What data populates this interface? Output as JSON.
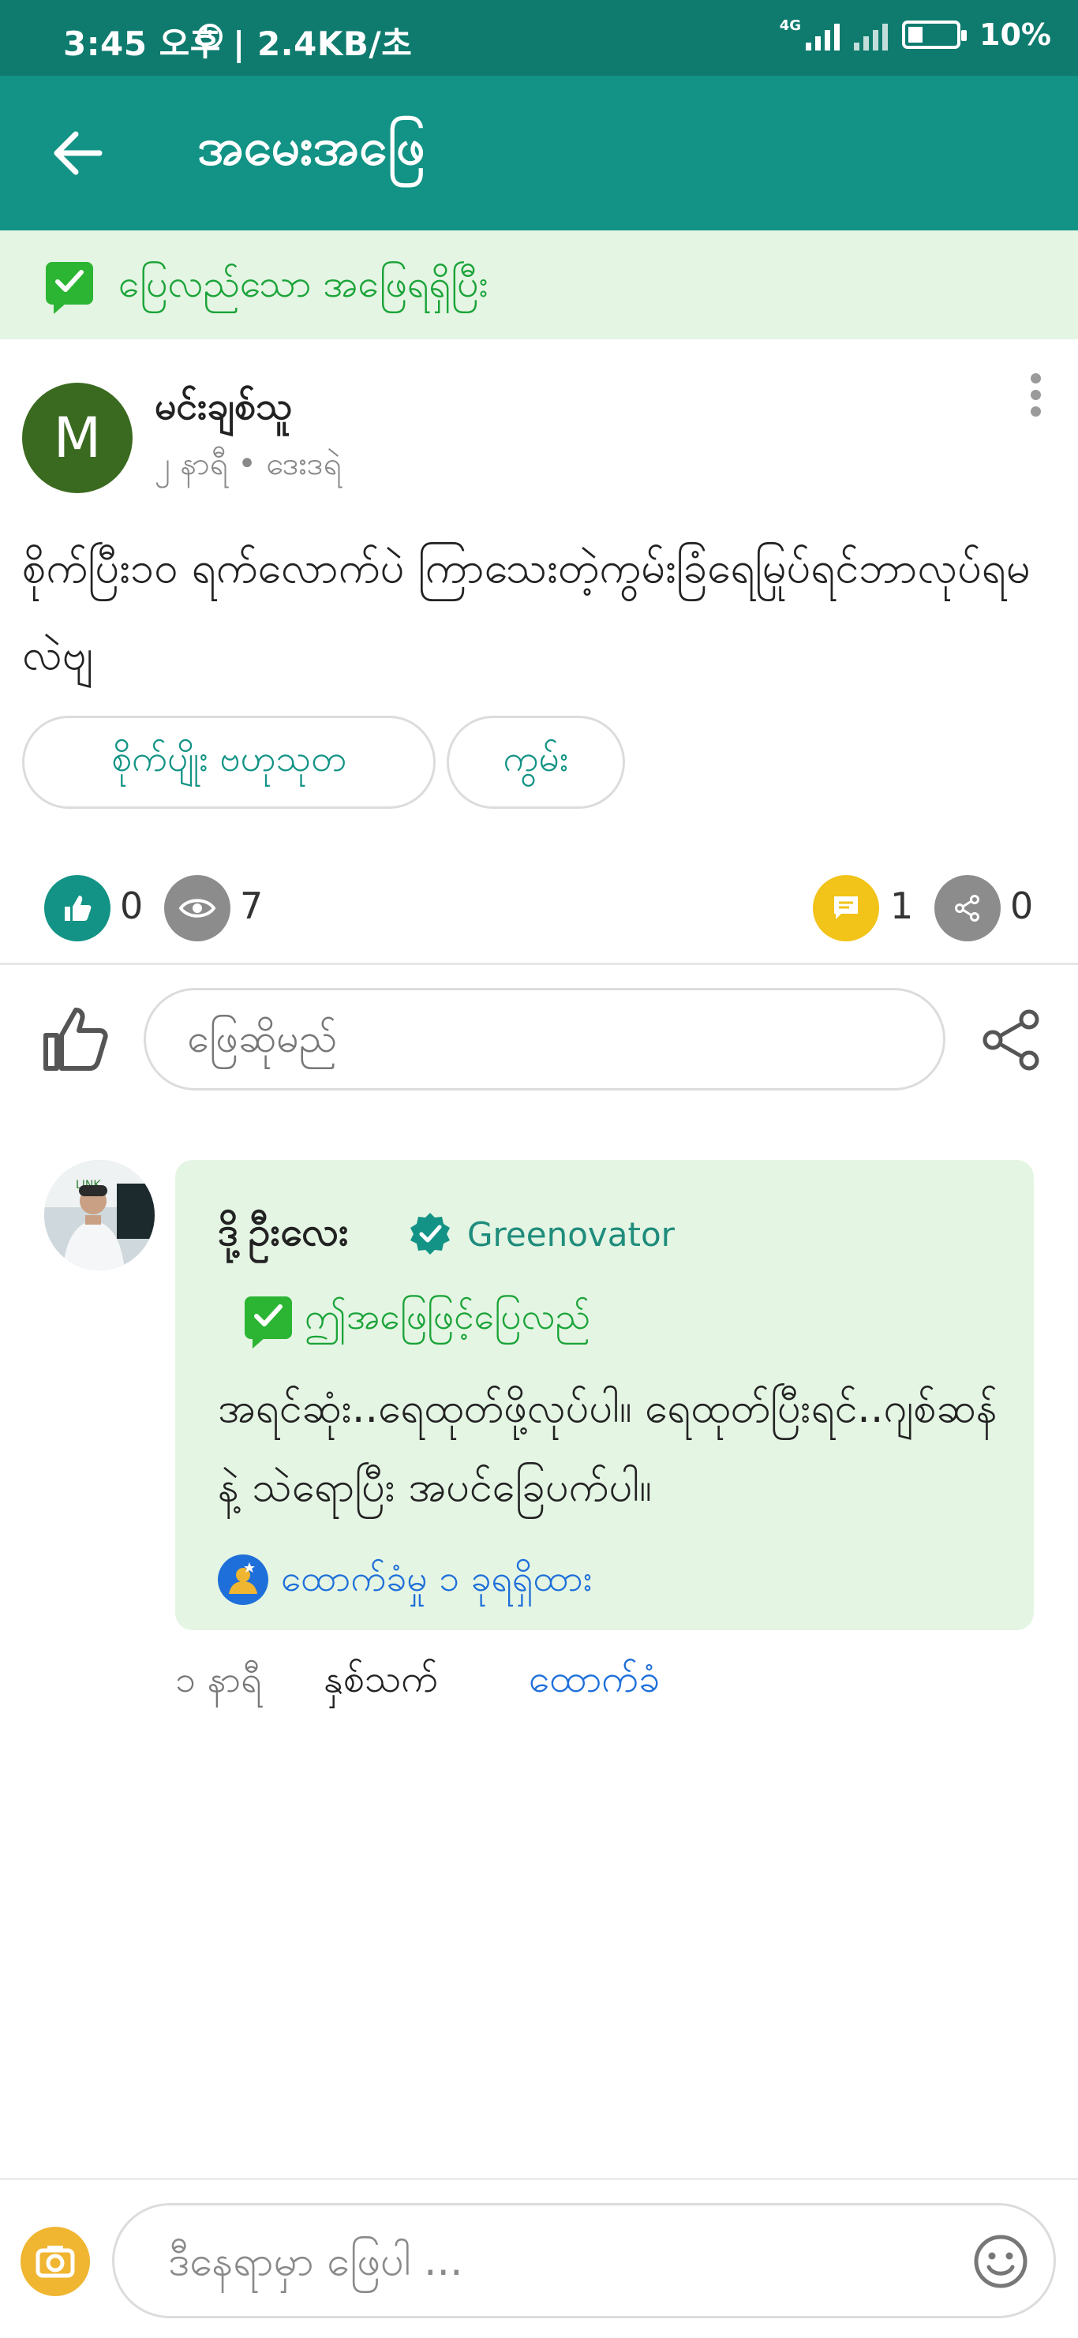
{
  "status_bar": {
    "time": "3:45 오후 | 2.4KB/초",
    "network": "4G",
    "battery": "10%"
  },
  "header": {
    "title": "အမေးအဖြေ"
  },
  "banner": {
    "text": "ပြေလည်သော အဖြေရရှိပြီး"
  },
  "question": {
    "avatar_letter": "M",
    "author": "မင်းချစ်သူ",
    "meta": "၂ နာရီ • ဒေးဒရဲ",
    "text": "စိုက်ပြီး၁၀ ရက်လောက်ပဲ ကြာသေးတဲ့ကွမ်းခြံရေမြုပ်ရင်ဘာလုပ်ရမလဲဗျ",
    "tags": [
      "စိုက်ပျိုး ဗဟုသုတ",
      "ကွမ်း"
    ],
    "stats": {
      "likes": "0",
      "views": "7",
      "answers": "1",
      "shares": "0"
    }
  },
  "answer_input": {
    "placeholder": "ဖြေဆိုမည်"
  },
  "answer": {
    "author": "ဒို့ဦးလေး",
    "role": "Greenovator",
    "accepted_label": "ဤအဖြေဖြင့်ပြေလည်",
    "text": "အရင်ဆုံး..ရေထုတ်ဖို့လုပ်ပါ။ ရေထုတ်ပြီးရင်..ဂျစ်ဆန်နဲ့ သဲရောပြီး အပင်ခြေပက်ပါ။",
    "support_text": "ထောက်ခံမှု ၁ ခုရရှိထား",
    "time": "၁ နာရီ",
    "react_label": "နှစ်သက်",
    "support_button": "ထောက်ခံ"
  },
  "composer": {
    "placeholder": "ဒီနေရာမှာ ဖြေပါ ..."
  },
  "colors": {
    "header": "#129385",
    "statusbar": "#0e7b6e",
    "accepted_green": "#2bb533",
    "link_blue": "#1e6fd9"
  }
}
